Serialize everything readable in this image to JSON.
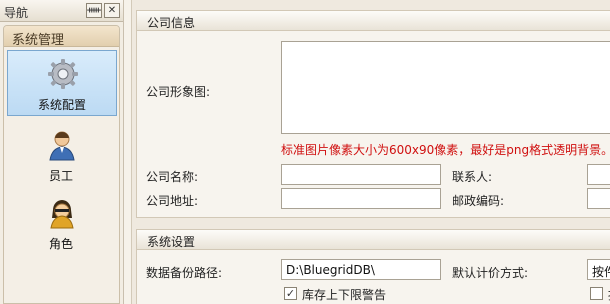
{
  "nav": {
    "title": "导航",
    "pin_icon": "pin-icon",
    "pin_glyph": "ᚔ",
    "close_glyph": "✕",
    "group_title": "系统管理",
    "items": [
      {
        "label": "系统配置",
        "icon": "gear-icon",
        "selected": true
      },
      {
        "label": "员工",
        "icon": "user-icon",
        "selected": false
      },
      {
        "label": "角色",
        "icon": "role-icon",
        "selected": false
      }
    ]
  },
  "company": {
    "section_title": "公司信息",
    "logo_label": "公司形象图:",
    "logo_hint": "标准图片像素大小为600x90像素，最好是png格式透明背景。",
    "name_label": "公司名称:",
    "name_value": "",
    "contact_label": "联系人:",
    "contact_value": "",
    "address_label": "公司地址:",
    "address_value": "",
    "postcode_label": "邮政编码:",
    "postcode_value": ""
  },
  "system": {
    "section_title": "系统设置",
    "backup_label": "数据备份路径:",
    "backup_value": "D:\\BluegridDB\\",
    "pricing_label": "默认计价方式:",
    "pricing_value": "按件",
    "stock_warning_label": "库存上下限警告",
    "stock_warning_checked": true,
    "check_mark": "✓",
    "second_checkbox_label": "按",
    "second_checkbox_checked": false
  },
  "colors": {
    "hint_red": "#d01010",
    "selected_bg": "#bcdaf3",
    "group_header": "#e2cfae"
  }
}
